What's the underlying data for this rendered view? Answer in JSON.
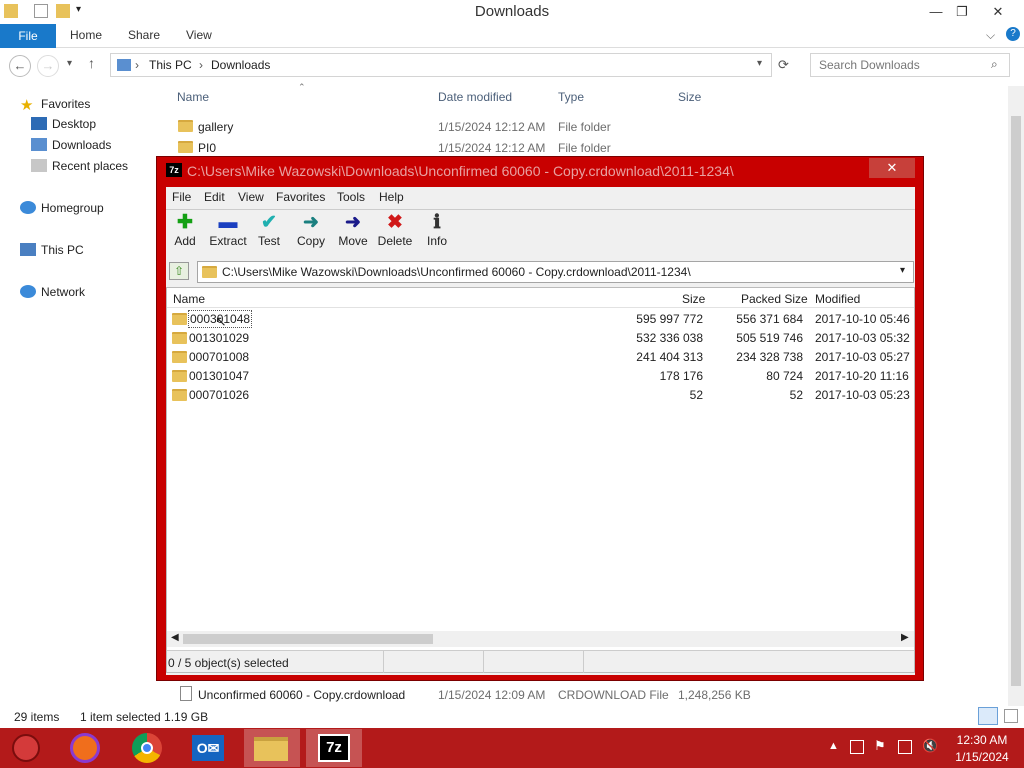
{
  "explorer": {
    "title": "Downloads",
    "ribbon_tabs": [
      "File",
      "Home",
      "Share",
      "View"
    ],
    "breadcrumb": [
      "This PC",
      "Downloads"
    ],
    "search_placeholder": "Search Downloads",
    "columns": [
      "Name",
      "Date modified",
      "Type",
      "Size"
    ],
    "nav": {
      "favorites": "Favorites",
      "desktop": "Desktop",
      "downloads": "Downloads",
      "recent": "Recent places",
      "homegroup": "Homegroup",
      "thispc": "This PC",
      "network": "Network"
    },
    "files": [
      {
        "name": "gallery",
        "date": "1/15/2024 12:12 AM",
        "type": "File folder",
        "size": ""
      },
      {
        "name": "PI0",
        "date": "1/15/2024 12:12 AM",
        "type": "File folder",
        "size": ""
      },
      {
        "name": "Unconfirmed 60060 - Copy.crdownload",
        "date": "1/15/2024 12:09 AM",
        "type": "CRDOWNLOAD File",
        "size": "1,248,256 KB"
      }
    ],
    "status": {
      "count": "29 items",
      "selected": "1 item selected  1.19 GB"
    }
  },
  "zip": {
    "caption": "C:\\Users\\Mike Wazowski\\Downloads\\Unconfirmed 60060 - Copy.crdownload\\2011-1234\\",
    "menu": [
      "File",
      "Edit",
      "View",
      "Favorites",
      "Tools",
      "Help"
    ],
    "tools": [
      {
        "label": "Add",
        "icon": "add-icon"
      },
      {
        "label": "Extract",
        "icon": "extract-icon"
      },
      {
        "label": "Test",
        "icon": "test-icon"
      },
      {
        "label": "Copy",
        "icon": "copy-icon"
      },
      {
        "label": "Move",
        "icon": "move-icon"
      },
      {
        "label": "Delete",
        "icon": "delete-icon"
      },
      {
        "label": "Info",
        "icon": "info-icon"
      }
    ],
    "path": "C:\\Users\\Mike Wazowski\\Downloads\\Unconfirmed 60060 - Copy.crdownload\\2011-1234\\",
    "columns": [
      "Name",
      "Size",
      "Packed Size",
      "Modified"
    ],
    "rows": [
      {
        "name": "000301048",
        "size": "595 997 772",
        "packed": "556 371 684",
        "modified": "2017-10-10 05:46"
      },
      {
        "name": "001301029",
        "size": "532 336 038",
        "packed": "505 519 746",
        "modified": "2017-10-03 05:32"
      },
      {
        "name": "000701008",
        "size": "241 404 313",
        "packed": "234 328 738",
        "modified": "2017-10-03 05:27"
      },
      {
        "name": "001301047",
        "size": "178 176",
        "packed": "80 724",
        "modified": "2017-10-20 11:16"
      },
      {
        "name": "000701026",
        "size": "52",
        "packed": "52",
        "modified": "2017-10-03 05:23"
      }
    ],
    "status": "0 / 5 object(s) selected"
  },
  "taskbar": {
    "time": "12:30 AM",
    "date": "1/15/2024",
    "apps": [
      "start-icon",
      "firefox-icon",
      "chrome-icon",
      "outlook-icon",
      "file-explorer-icon",
      "7zip-icon"
    ]
  },
  "colors": {
    "taskbar": "#b31a1a",
    "zip_frame": "#c80000",
    "ribbon_file": "#1979ca"
  }
}
